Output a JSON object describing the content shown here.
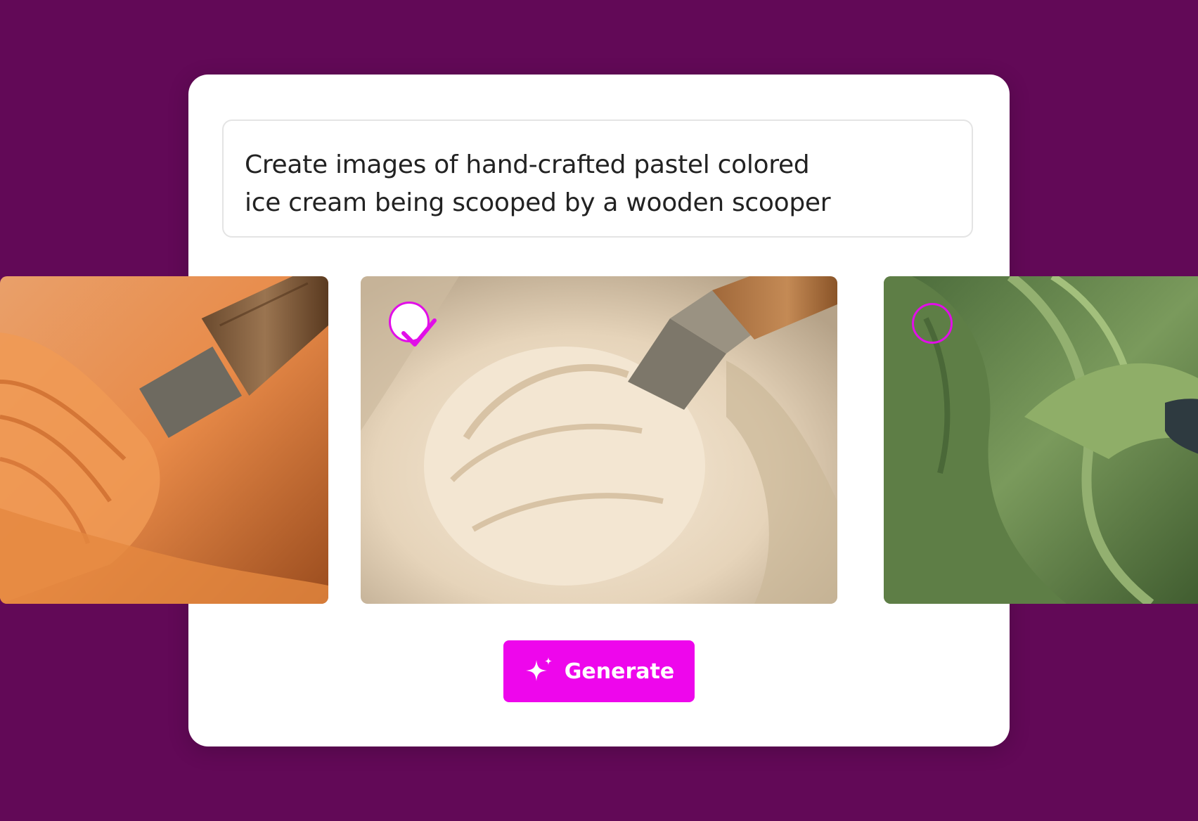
{
  "prompt": {
    "line1": "Create images of hand-crafted pastel colored",
    "line2": "ice cream being scooped by a wooden scooper"
  },
  "images": [
    {
      "subject": "orange ice cream scooped by wooden scooper",
      "selected": false
    },
    {
      "subject": "vanilla ice cream scooped by wooden scooper",
      "selected": true
    },
    {
      "subject": "green ice cream swirl",
      "selected": false
    }
  ],
  "generate_button": {
    "label": "Generate",
    "icon": "sparkle-icon"
  },
  "colors": {
    "background": "#620957",
    "accent": "#ee06ec",
    "card": "#ffffff"
  }
}
